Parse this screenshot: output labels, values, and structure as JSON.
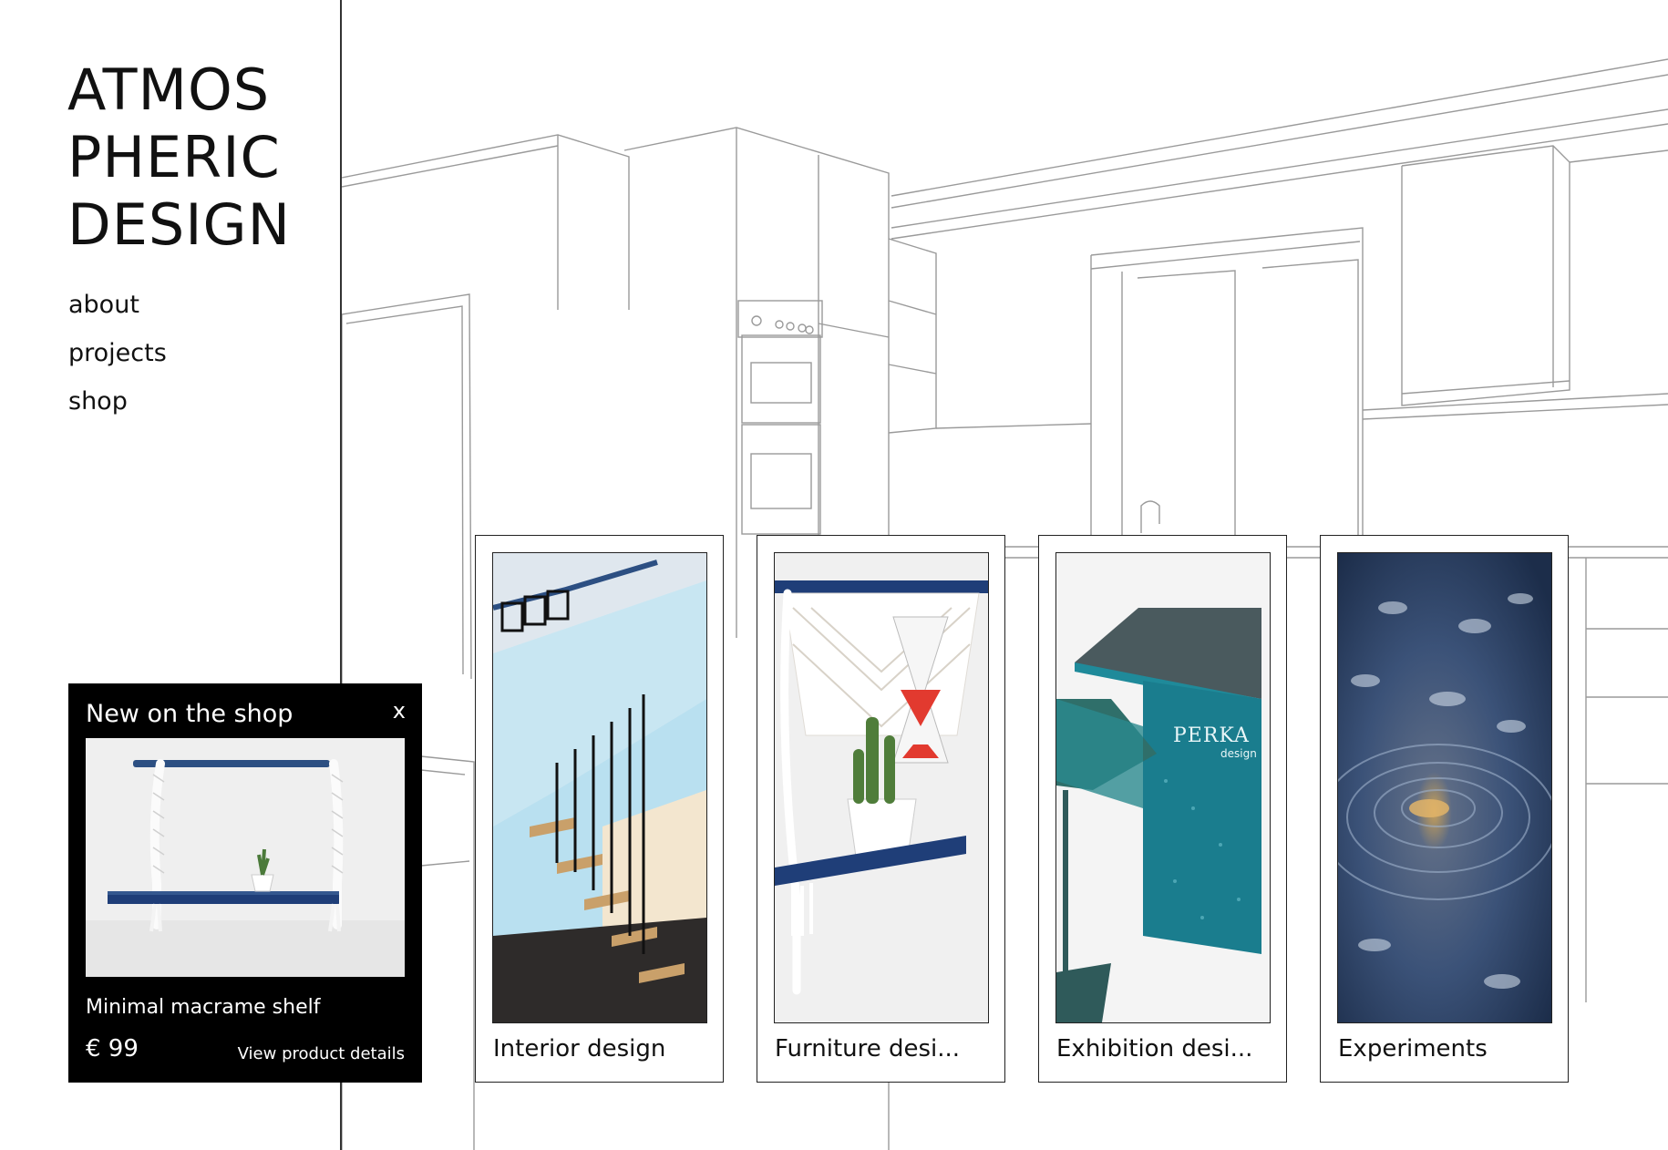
{
  "brand": {
    "lines": [
      "ATMOS",
      "PHERIC",
      "DESIGN"
    ]
  },
  "nav": {
    "items": [
      {
        "label": "about"
      },
      {
        "label": "projects"
      },
      {
        "label": "shop"
      }
    ]
  },
  "shop_popup": {
    "title": "New on the shop",
    "close_label": "x",
    "product_name": "Minimal macrame shelf",
    "price": "€ 99",
    "details_link": "View product details"
  },
  "categories": [
    {
      "label": "Interior design",
      "image_icon": "staircase-photo"
    },
    {
      "label": "Furniture desi...",
      "image_icon": "macrame-shelf-photo"
    },
    {
      "label": "Exhibition desi...",
      "image_icon": "perka-stand-photo"
    },
    {
      "label": "Experiments",
      "image_icon": "abstract-blue-photo"
    }
  ],
  "exhibition_photo_text": {
    "brand": "PERKA",
    "sub": "design"
  },
  "colors": {
    "accent_blue": "#1f3e78",
    "teal": "#1f8a9a",
    "popup_bg": "#000000",
    "hourglass_red": "#e23a2f"
  }
}
